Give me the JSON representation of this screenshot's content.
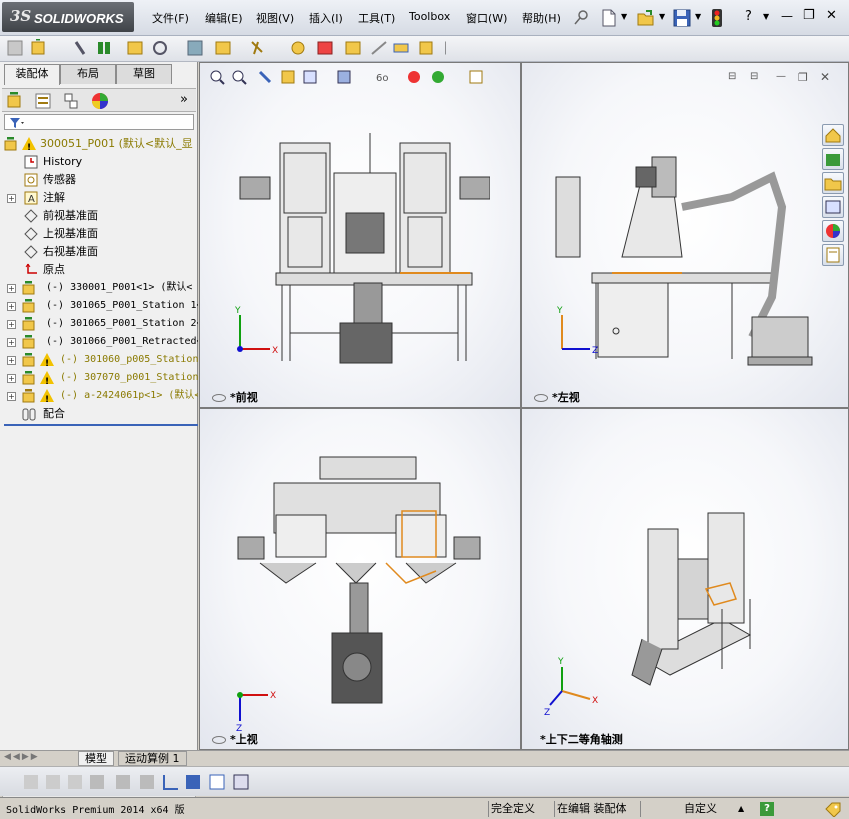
{
  "app": {
    "logo_ds": "3S",
    "logo_text": "SOLIDWORKS"
  },
  "menu": {
    "items": [
      "文件(F)",
      "编辑(E)",
      "视图(V)",
      "插入(I)",
      "工具(T)",
      "Toolbox",
      "窗口(W)",
      "帮助(H)"
    ]
  },
  "window_controls": {
    "help": "?",
    "minimize": "—",
    "restore": "❐",
    "close": "✕"
  },
  "panel": {
    "tabs": [
      "装配体",
      "布局",
      "草图"
    ],
    "expand_symbol": "»"
  },
  "tree": {
    "items": [
      {
        "label": "300051_P001   (默认<默认_显",
        "warn": true
      },
      {
        "label": "History"
      },
      {
        "label": "传感器"
      },
      {
        "label": "注解"
      },
      {
        "label": "前视基准面"
      },
      {
        "label": "上视基准面"
      },
      {
        "label": "右视基准面"
      },
      {
        "label": "原点"
      },
      {
        "label": "(-) 330001_P001<1> (默认<"
      },
      {
        "label": "(-) 301065_P001_Station 1<"
      },
      {
        "label": "(-) 301065_P001_Station 2<"
      },
      {
        "label": "(-) 301066_P001_Retracted<"
      },
      {
        "label": "(-) 301060_p005_Station",
        "warn": true
      },
      {
        "label": "(-) 307070_p001_Station",
        "warn": true
      },
      {
        "label": "(-) a-2424061p<1> (默认<",
        "warn": true
      },
      {
        "label": "配合"
      }
    ]
  },
  "viewports": {
    "front": "*前视",
    "left": "*左视",
    "top": "*上视",
    "iso": "*上下二等角轴测"
  },
  "axes": {
    "x": "X",
    "y": "Y",
    "z": "Z"
  },
  "bottom_tabs": {
    "model": "模型",
    "motion": "运动算例 1"
  },
  "status": {
    "product": "SolidWorks Premium 2014 x64 版",
    "defined": "完全定义",
    "editing": "在编辑 装配体",
    "custom": "自定义",
    "caret": "▲",
    "help_icon": "?"
  },
  "colors": {
    "accent_orange": "#e08a1e",
    "axis_red": "#d01010",
    "axis_green": "#10a010",
    "axis_blue": "#1010d0",
    "warn_yellow": "#f2c200"
  }
}
